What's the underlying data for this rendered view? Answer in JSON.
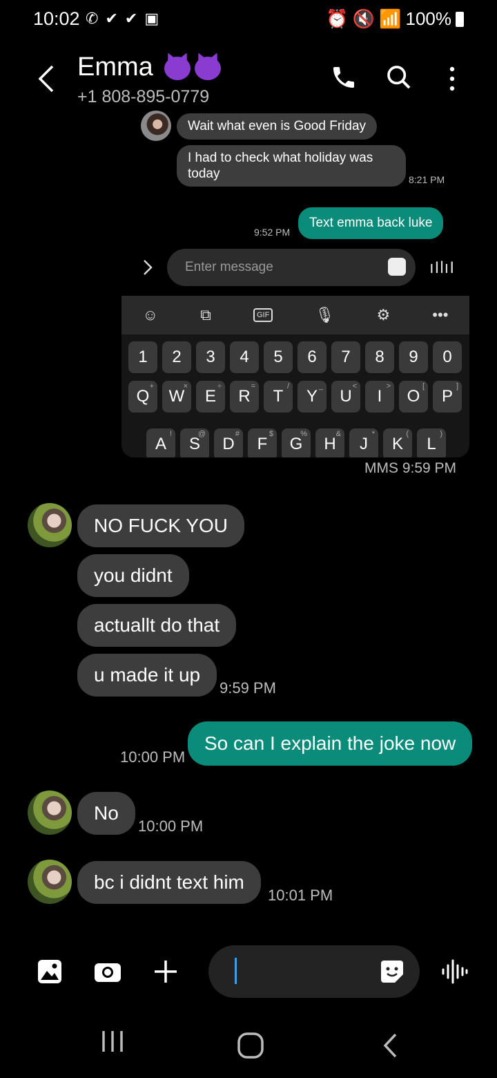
{
  "status_bar": {
    "time": "10:02",
    "battery": "100%",
    "network": "4G"
  },
  "header": {
    "contact_name": "Emma",
    "contact_number": "+1 808-895-0779"
  },
  "embedded_screenshot": {
    "messages": [
      {
        "text": "Wait what even is Good Friday"
      },
      {
        "text": "I had to check what holiday was today",
        "time": "8:21 PM"
      },
      {
        "text": "Text emma back luke",
        "time": "9:52 PM"
      }
    ],
    "input_placeholder": "Enter message",
    "keyboard": {
      "numbers": [
        "1",
        "2",
        "3",
        "4",
        "5",
        "6",
        "7",
        "8",
        "9",
        "0"
      ],
      "row1": [
        "Q",
        "W",
        "E",
        "R",
        "T",
        "Y",
        "U",
        "I",
        "O",
        "P"
      ],
      "row1_symbols": [
        "+",
        "×",
        "÷",
        "=",
        "/",
        "_",
        "<",
        ">",
        "[",
        "]"
      ],
      "row2": [
        "A",
        "S",
        "D",
        "F",
        "G",
        "H",
        "J",
        "K",
        "L"
      ],
      "row2_symbols": [
        "!",
        "@",
        "#",
        "$",
        "%",
        "&",
        "*",
        "(",
        ")"
      ],
      "gif_label": "GIF"
    },
    "caption": "MMS 9:59 PM"
  },
  "messages": [
    {
      "text": "NO FUCK YOU"
    },
    {
      "text": "you didnt"
    },
    {
      "text": "actuallt do that"
    },
    {
      "text": "u made it up",
      "time": "9:59 PM"
    },
    {
      "text": "So can I explain the joke now",
      "time": "10:00 PM"
    },
    {
      "text": "No",
      "time": "10:00 PM"
    },
    {
      "text": "bc i didnt text him",
      "time": "10:01 PM"
    }
  ]
}
